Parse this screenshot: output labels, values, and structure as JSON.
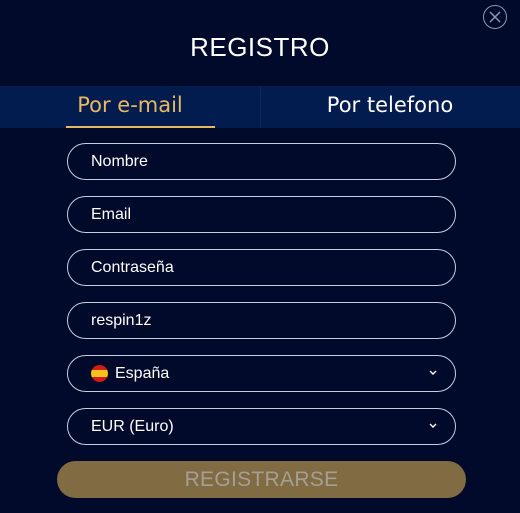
{
  "modal": {
    "title": "REGISTRO",
    "close_icon": "close-icon"
  },
  "tabs": [
    {
      "label": "Por e-mail",
      "active": true
    },
    {
      "label": "Por telefono",
      "active": false
    }
  ],
  "form": {
    "name_placeholder": "Nombre",
    "email_placeholder": "Email",
    "password_placeholder": "Contraseña",
    "promo_value": "respin1z",
    "country_value": "España",
    "country_flag_icon": "spain-flag-icon",
    "currency_value": "EUR (Euro)",
    "submit_label": "REGISTRARSE"
  },
  "colors": {
    "background": "#020a2c",
    "tab_bar": "#031c4f",
    "accent": "#e7b960",
    "submit_bg": "#806b42",
    "submit_text": "#a69f96"
  }
}
